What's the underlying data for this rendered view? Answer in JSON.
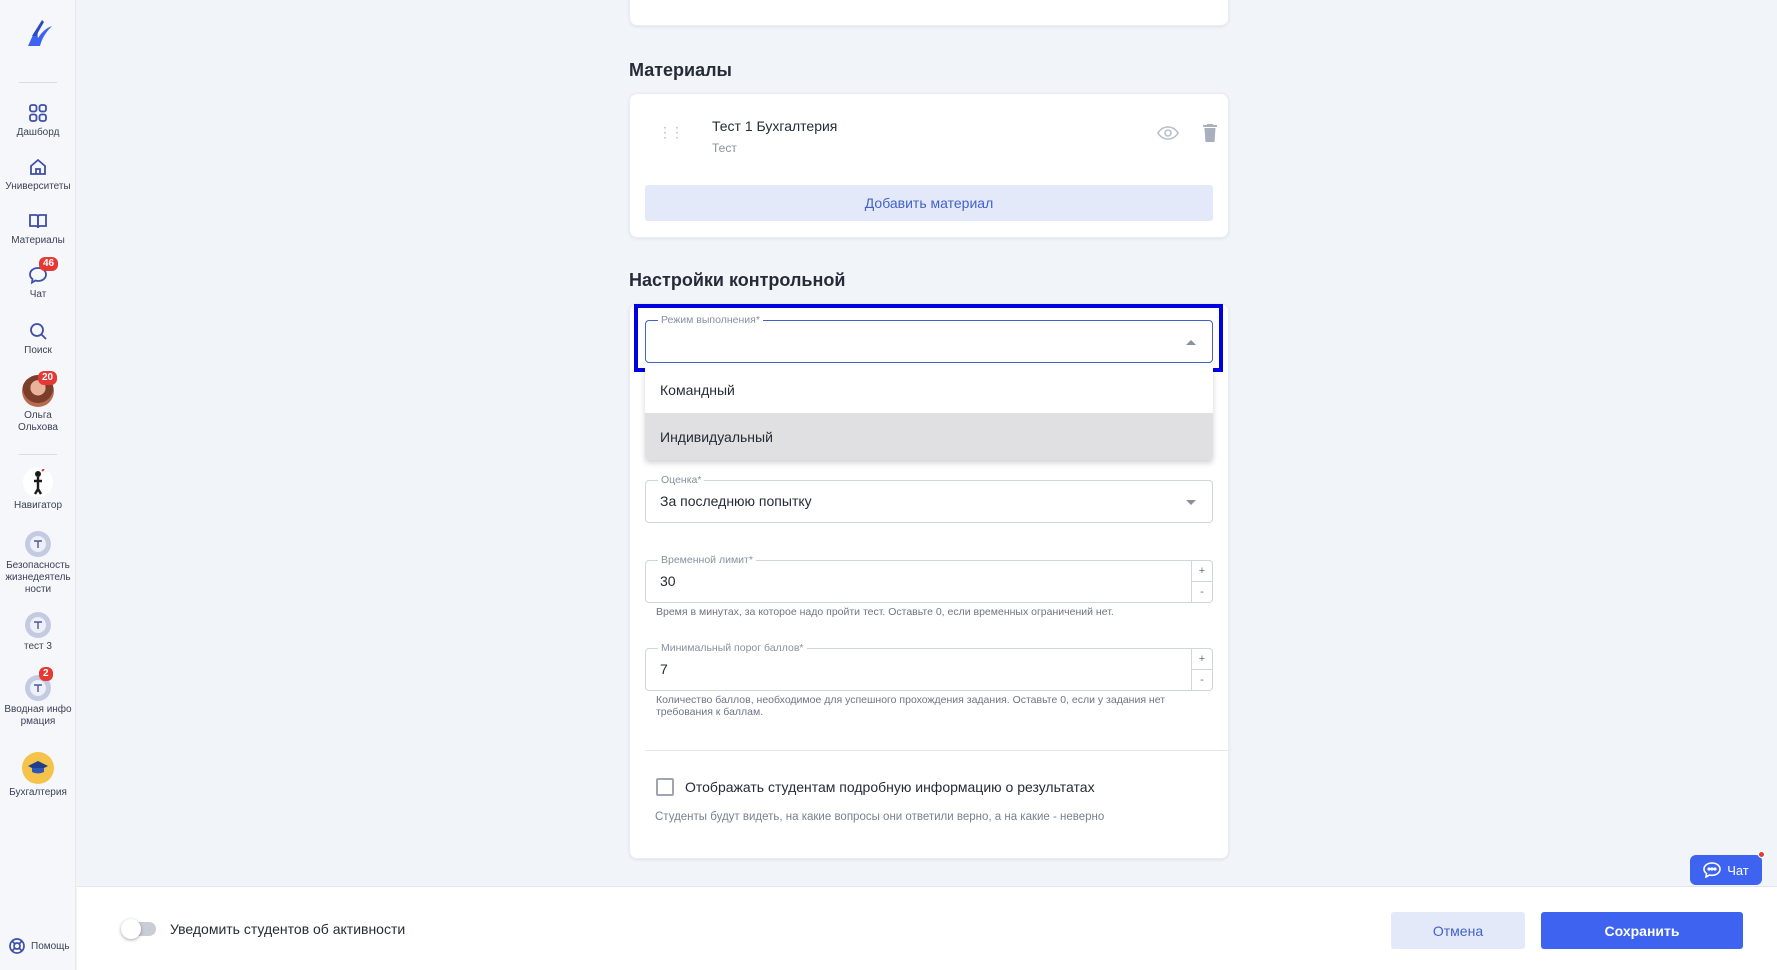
{
  "sidebar": {
    "items": [
      {
        "label": "Дашборд",
        "icon": "grid-icon"
      },
      {
        "label": "Университеты",
        "icon": "home-icon"
      },
      {
        "label": "Материалы",
        "icon": "book-icon"
      },
      {
        "label": "Чат",
        "icon": "chat-icon",
        "badge": "46"
      },
      {
        "label": "Поиск",
        "icon": "search-icon"
      },
      {
        "label": "Ольга\nОльхова",
        "icon": "avatar",
        "badge": "20"
      },
      {
        "label": "Навигатор",
        "icon": "navigator-icon"
      },
      {
        "label": "Безопасность\nжизнедеятель\nности",
        "icon": "course-icon"
      },
      {
        "label": "тест 3",
        "icon": "course-icon"
      },
      {
        "label": "Вводная инфо\nрмация",
        "icon": "course-icon",
        "badge": "2"
      },
      {
        "label": "Бухгалтерия",
        "icon": "graduation-icon"
      }
    ],
    "help_label": "Помощь"
  },
  "materials": {
    "title": "Материалы",
    "items": [
      {
        "title": "Тест 1 Бухгалтерия",
        "type": "Тест"
      }
    ],
    "add_label": "Добавить материал"
  },
  "settings": {
    "title": "Настройки контрольной",
    "mode": {
      "label": "Режим выполнения*",
      "value": "",
      "options": [
        "Командный",
        "Индивидуальный"
      ],
      "highlighted": "Индивидуальный"
    },
    "grade": {
      "label": "Оценка*",
      "value": "За последнюю попытку"
    },
    "time_limit": {
      "label": "Временной лимит*",
      "value": "30",
      "helper": "Время в минутах, за которое надо пройти тест. Оставьте 0, если временных ограничений нет."
    },
    "min_score": {
      "label": "Минимальный порог баллов*",
      "value": "7",
      "helper": "Количество баллов, необходимое для успешного прохождения задания. Оставьте 0, если у задания нет требования к баллам."
    },
    "show_results": {
      "label": "Отображать студентам подробную информацию о результатах",
      "helper": "Студенты будут видеть, на какие вопросы они ответили верно, а на какие - неверно",
      "checked": false
    },
    "stepper_plus": "+",
    "stepper_minus": "-"
  },
  "footer": {
    "notify_label": "Уведомить студентов об активности",
    "notify_on": false,
    "cancel_label": "Отмена",
    "save_label": "Сохранить"
  },
  "chat_fab": {
    "label": "Чат"
  },
  "colors": {
    "accent": "#3d63f0",
    "highlight": "#0000e0",
    "badge": "#e53935"
  }
}
